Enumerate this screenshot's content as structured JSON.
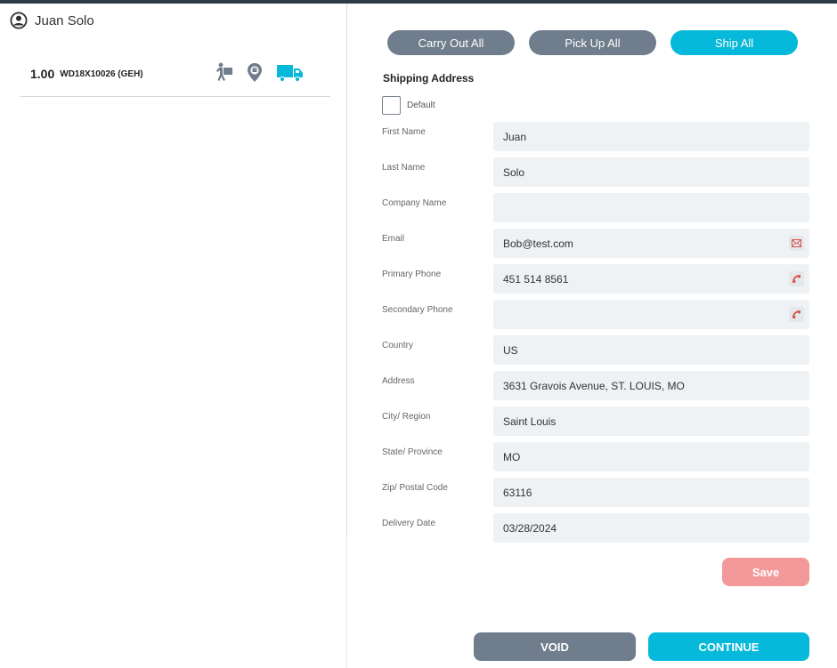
{
  "customer": {
    "name": "Juan Solo",
    "icon": "user-circle-icon"
  },
  "order_item": {
    "quantity": "1.00",
    "sku": "WD18X10026 (GEH)",
    "icons": [
      "carry-out-icon",
      "pick-up-location-icon",
      "ship-truck-icon"
    ],
    "selected_fulfillment": "ship"
  },
  "fulfillment": {
    "carry_out_all": "Carry Out All",
    "pick_up_all": "Pick Up All",
    "ship_all": "Ship All"
  },
  "shipping": {
    "title": "Shipping Address",
    "default_label": "Default",
    "default_checked": false,
    "fields": {
      "first_name": {
        "label": "First Name",
        "value": "Juan"
      },
      "last_name": {
        "label": "Last Name",
        "value": "Solo"
      },
      "company": {
        "label": "Company Name",
        "value": ""
      },
      "email": {
        "label": "Email",
        "value": "Bob@test.com",
        "icon": "envelope-icon"
      },
      "primary_phone": {
        "label": "Primary Phone",
        "value": "451 514 8561",
        "icon": "phone-icon"
      },
      "secondary_phone": {
        "label": "Secondary Phone",
        "value": "",
        "icon": "phone-icon"
      },
      "country": {
        "label": "Country",
        "value": "US"
      },
      "address": {
        "label": "Address",
        "value": "3631 Gravois Avenue, ST. LOUIS, MO"
      },
      "city": {
        "label": "City/ Region",
        "value": "Saint Louis"
      },
      "state": {
        "label": "State/ Province",
        "value": "MO"
      },
      "zip": {
        "label": "Zip/ Postal Code",
        "value": "63116"
      },
      "delivery_date": {
        "label": "Delivery Date",
        "value": "03/28/2024"
      }
    },
    "save_label": "Save"
  },
  "actions": {
    "void_label": "VOID",
    "continue_label": "CONTINUE"
  },
  "colors": {
    "accent": "#06b8d9",
    "neutral_button": "#6f7d8c",
    "save_button": "#f4999a",
    "field_background": "#eef2f4",
    "icon_red": "#d9534f",
    "topbar": "#2e3a46"
  }
}
